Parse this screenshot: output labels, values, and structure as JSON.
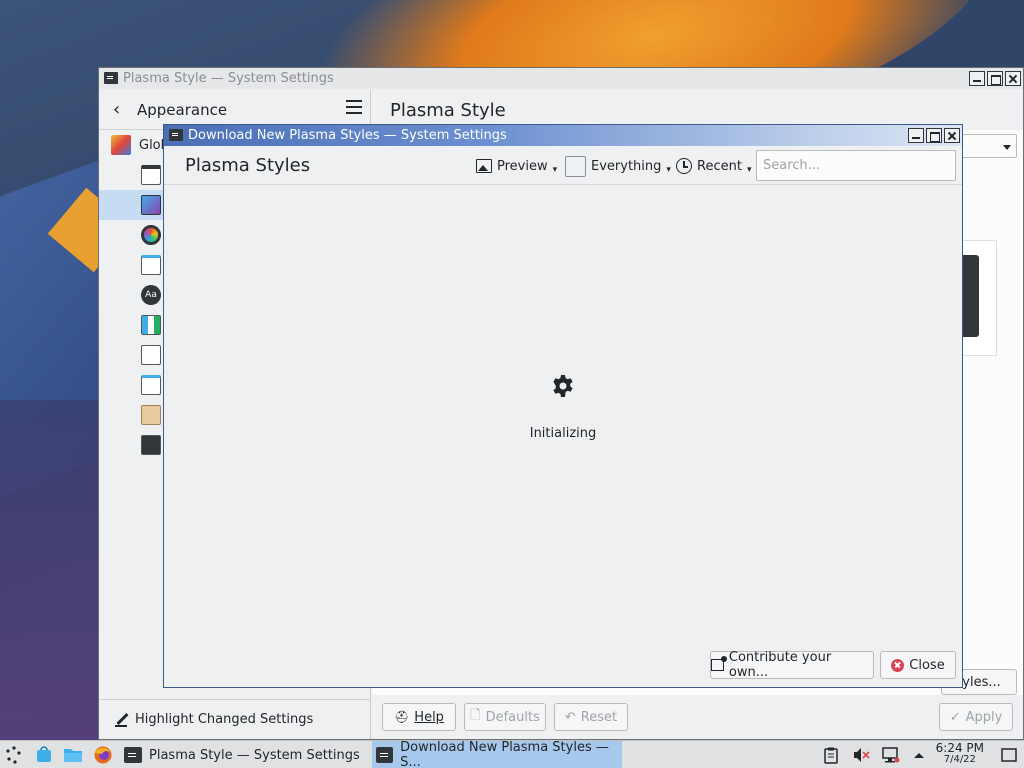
{
  "back_window": {
    "title": "Plasma Style — System Settings",
    "sidebar": {
      "header": "Appearance",
      "first_item": "Glob",
      "footer": "Highlight Changed Settings"
    },
    "main_title": "Plasma Style",
    "get_new_label": "tyles...",
    "buttons": {
      "help": "Help",
      "defaults": "Defaults",
      "reset": "Reset",
      "apply": "Apply"
    }
  },
  "dialog": {
    "title": "Download New Plasma Styles — System Settings",
    "heading": "Plasma Styles",
    "toolbar": {
      "preview": "Preview",
      "everything": "Everything",
      "recent": "Recent"
    },
    "search_placeholder": "Search...",
    "status": "Initializing",
    "buttons": {
      "contribute": "Contribute your own...",
      "close": "Close"
    }
  },
  "taskbar": {
    "tasks": [
      {
        "label": "Plasma Style  — System Settings"
      },
      {
        "label": "Download New Plasma Styles — S..."
      }
    ],
    "time": "6:24 PM",
    "date": "7/4/22"
  },
  "colors": {
    "accent": "#3daee9",
    "selection": "#c5dcf2",
    "close_red": "#da4453",
    "titlebar_active": "#4a6fb5"
  }
}
